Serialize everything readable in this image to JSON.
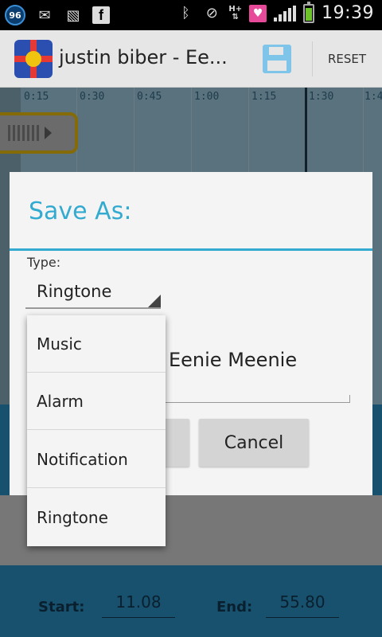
{
  "status_bar": {
    "notification_count": "96",
    "hplus_label": "H+",
    "time": "19:39",
    "icons": [
      "notification-badge",
      "mail-icon",
      "image-icon",
      "facebook-icon",
      "bluetooth-icon",
      "silent-mode-icon",
      "hplus-data-icon",
      "heart-app-icon",
      "signal-icon",
      "battery-icon"
    ],
    "battery_level": 0.85
  },
  "action_bar": {
    "title": "justin biber - Ee...",
    "save_icon": "save-icon",
    "reset_label": "RESET"
  },
  "timeline": {
    "ticks": [
      "0:15",
      "0:30",
      "0:45",
      "1:00",
      "1:15",
      "1:30",
      "1:4"
    ]
  },
  "bottom_panel": {
    "start_label": "Start:",
    "start_value": "11.08",
    "end_label": "End:",
    "end_value": "55.80"
  },
  "dialog": {
    "title": "Save As:",
    "type_label": "Type:",
    "type_selected": "Ringtone",
    "name_value": "Eenie Meenie",
    "cancel_label": "Cancel"
  },
  "dropdown": {
    "options": [
      "Music",
      "Alarm",
      "Notification",
      "Ringtone"
    ]
  },
  "colors": {
    "accent": "#33aacf",
    "waveform_bg": "#a3cfe4",
    "panel_blue": "#2d94c8",
    "marker_border": "#f2c20f"
  }
}
